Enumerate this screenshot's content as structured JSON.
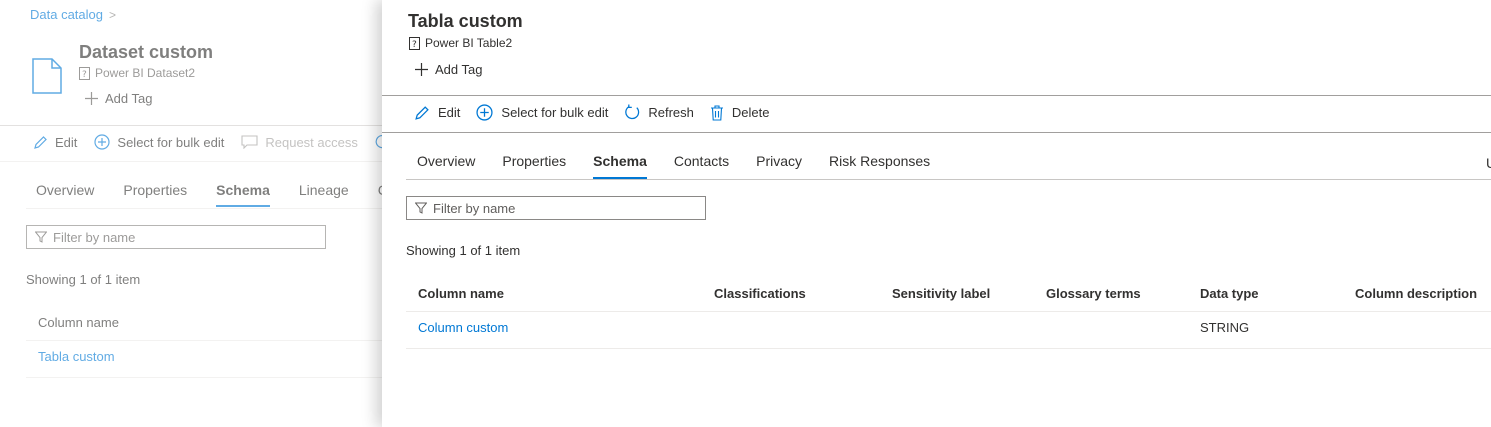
{
  "background_page": {
    "breadcrumb": {
      "label": "Data catalog",
      "separator": ">"
    },
    "title": "Dataset custom",
    "subtitle": "Power BI Dataset2",
    "add_tag": "Add Tag",
    "toolbar": [
      {
        "label": "Edit",
        "icon": "pencil-icon"
      },
      {
        "label": "Select for bulk edit",
        "icon": "add-circle-icon"
      },
      {
        "label": "Request access",
        "icon": "chat-icon"
      },
      {
        "label": "",
        "icon": "refresh-icon"
      }
    ],
    "tabs": [
      "Overview",
      "Properties",
      "Schema",
      "Lineage",
      "Co"
    ],
    "active_tab": "Schema",
    "filter_placeholder": "Filter by name",
    "showing": "Showing 1 of 1 item",
    "column_header": "Column name",
    "rows": [
      "Tabla custom"
    ]
  },
  "panel": {
    "title": "Tabla custom",
    "subtitle": "Power BI Table2",
    "add_tag": "Add Tag",
    "toolbar": [
      {
        "label": "Edit",
        "icon": "pencil-icon"
      },
      {
        "label": "Select for bulk edit",
        "icon": "add-circle-icon"
      },
      {
        "label": "Refresh",
        "icon": "refresh-icon"
      },
      {
        "label": "Delete",
        "icon": "trash-icon"
      }
    ],
    "tabs": [
      "Overview",
      "Properties",
      "Schema",
      "Contacts",
      "Privacy",
      "Risk Responses"
    ],
    "active_tab": "Schema",
    "tabs_overflow": "U",
    "filter_placeholder": "Filter by name",
    "showing": "Showing 1 of 1 item",
    "columns": [
      "Column name",
      "Classifications",
      "Sensitivity label",
      "Glossary terms",
      "Data type",
      "Column description"
    ],
    "rows": [
      {
        "column_name": "Column custom",
        "classifications": "",
        "sensitivity_label": "",
        "glossary_terms": "",
        "data_type": "STRING",
        "column_description": ""
      }
    ]
  },
  "colors": {
    "accent": "#0078d4",
    "text": "#323130",
    "muted": "#605e5c",
    "divider": "#edebe9"
  }
}
